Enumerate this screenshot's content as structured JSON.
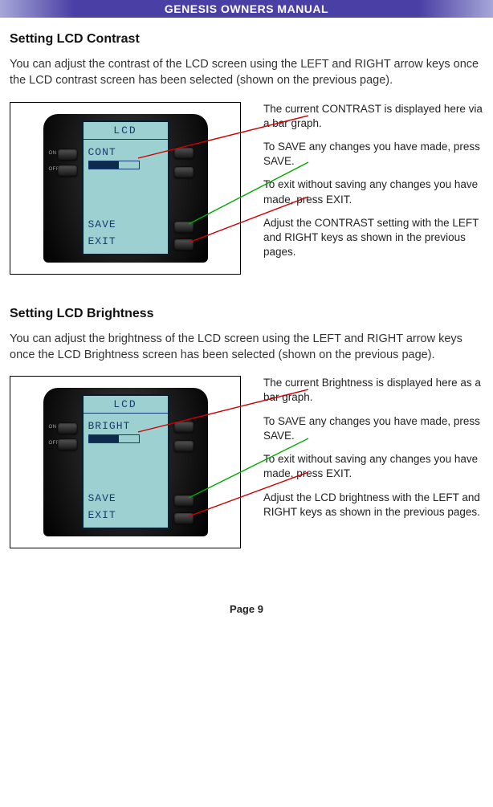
{
  "header": "GENESIS OWNERS MANUAL",
  "section1": {
    "title": "Setting LCD Contrast",
    "intro": "You can adjust the contrast of the LCD screen using the LEFT and RIGHT arrow keys once the LCD contrast screen has been selected (shown on the previous page).",
    "lcd": {
      "title": "LCD",
      "param": "CONT",
      "save": "SAVE",
      "exit": "EXIT",
      "btn_on": "ON",
      "btn_off": "OFF"
    },
    "callouts": {
      "c1": "The current CONTRAST is displayed here via a bar graph.",
      "c2": "To SAVE any changes you have made, press SAVE.",
      "c3": "To exit without saving any changes you have made, press EXIT.",
      "c4": "Adjust the CONTRAST setting with the LEFT and RIGHT keys as shown in the previous pages."
    }
  },
  "section2": {
    "title": "Setting LCD Brightness",
    "intro": "You can adjust the brightness of the LCD screen using the LEFT and RIGHT arrow keys once the LCD Brightness screen has been selected (shown on the previous page).",
    "lcd": {
      "title": "LCD",
      "param": "BRIGHT",
      "save": "SAVE",
      "exit": "EXIT",
      "btn_on": "ON",
      "btn_off": "OFF"
    },
    "callouts": {
      "c1": "The current Brightness is dis­played here as a bar graph.",
      "c2": "To SAVE any changes you have made, press SAVE.",
      "c3": "To exit without saving any changes you have made, press EXIT.",
      "c4": "Adjust the LCD brightness with the LEFT and RIGHT keys as shown in the previous pages."
    }
  },
  "footer": "Page 9"
}
